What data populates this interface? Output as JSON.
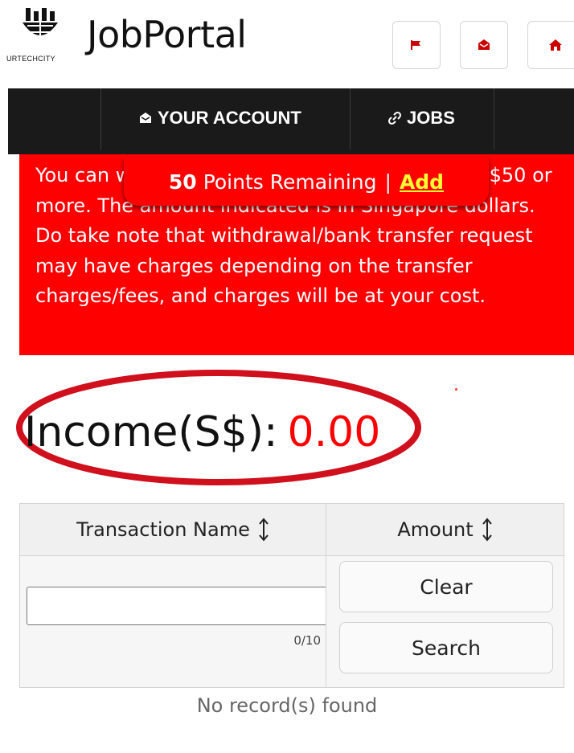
{
  "header": {
    "logo_text": "URTECHCITY",
    "brand": "JobPortal",
    "buttons": [
      {
        "icon": "flag-icon"
      },
      {
        "icon": "mail-icon"
      },
      {
        "icon": "home-icon"
      }
    ]
  },
  "nav": {
    "items": [
      {
        "label": "YOUR ACCOUNT",
        "icon": "envelope-icon"
      },
      {
        "label": "JOBS",
        "icon": "link-icon"
      }
    ]
  },
  "notice": {
    "text": "You can withdraw when your income reaches S$50 or more. The amount indicated is in Singapore dollars. Do take note that withdrawal/bank transfer request may have charges depending on the transfer charges/fees, and charges will be at your cost."
  },
  "points": {
    "count_label": "50",
    "remaining_label": "Points Remaining",
    "separator": "|",
    "add_label": "Add"
  },
  "income": {
    "label": "Income(S$):",
    "value": "0.00"
  },
  "table": {
    "columns": [
      {
        "label": "Transaction Name",
        "sort_icon": "sort-icon"
      },
      {
        "label": "Amount",
        "sort_icon": "sort-icon"
      }
    ],
    "filter": {
      "value": "",
      "counter": "0/10"
    },
    "clear_label": "Clear",
    "search_label": "Search",
    "empty_message": "No record(s) found"
  },
  "colors": {
    "accent_red": "#ff0000",
    "navbar": "#1a1a1a",
    "add_link": "#ffff33"
  }
}
